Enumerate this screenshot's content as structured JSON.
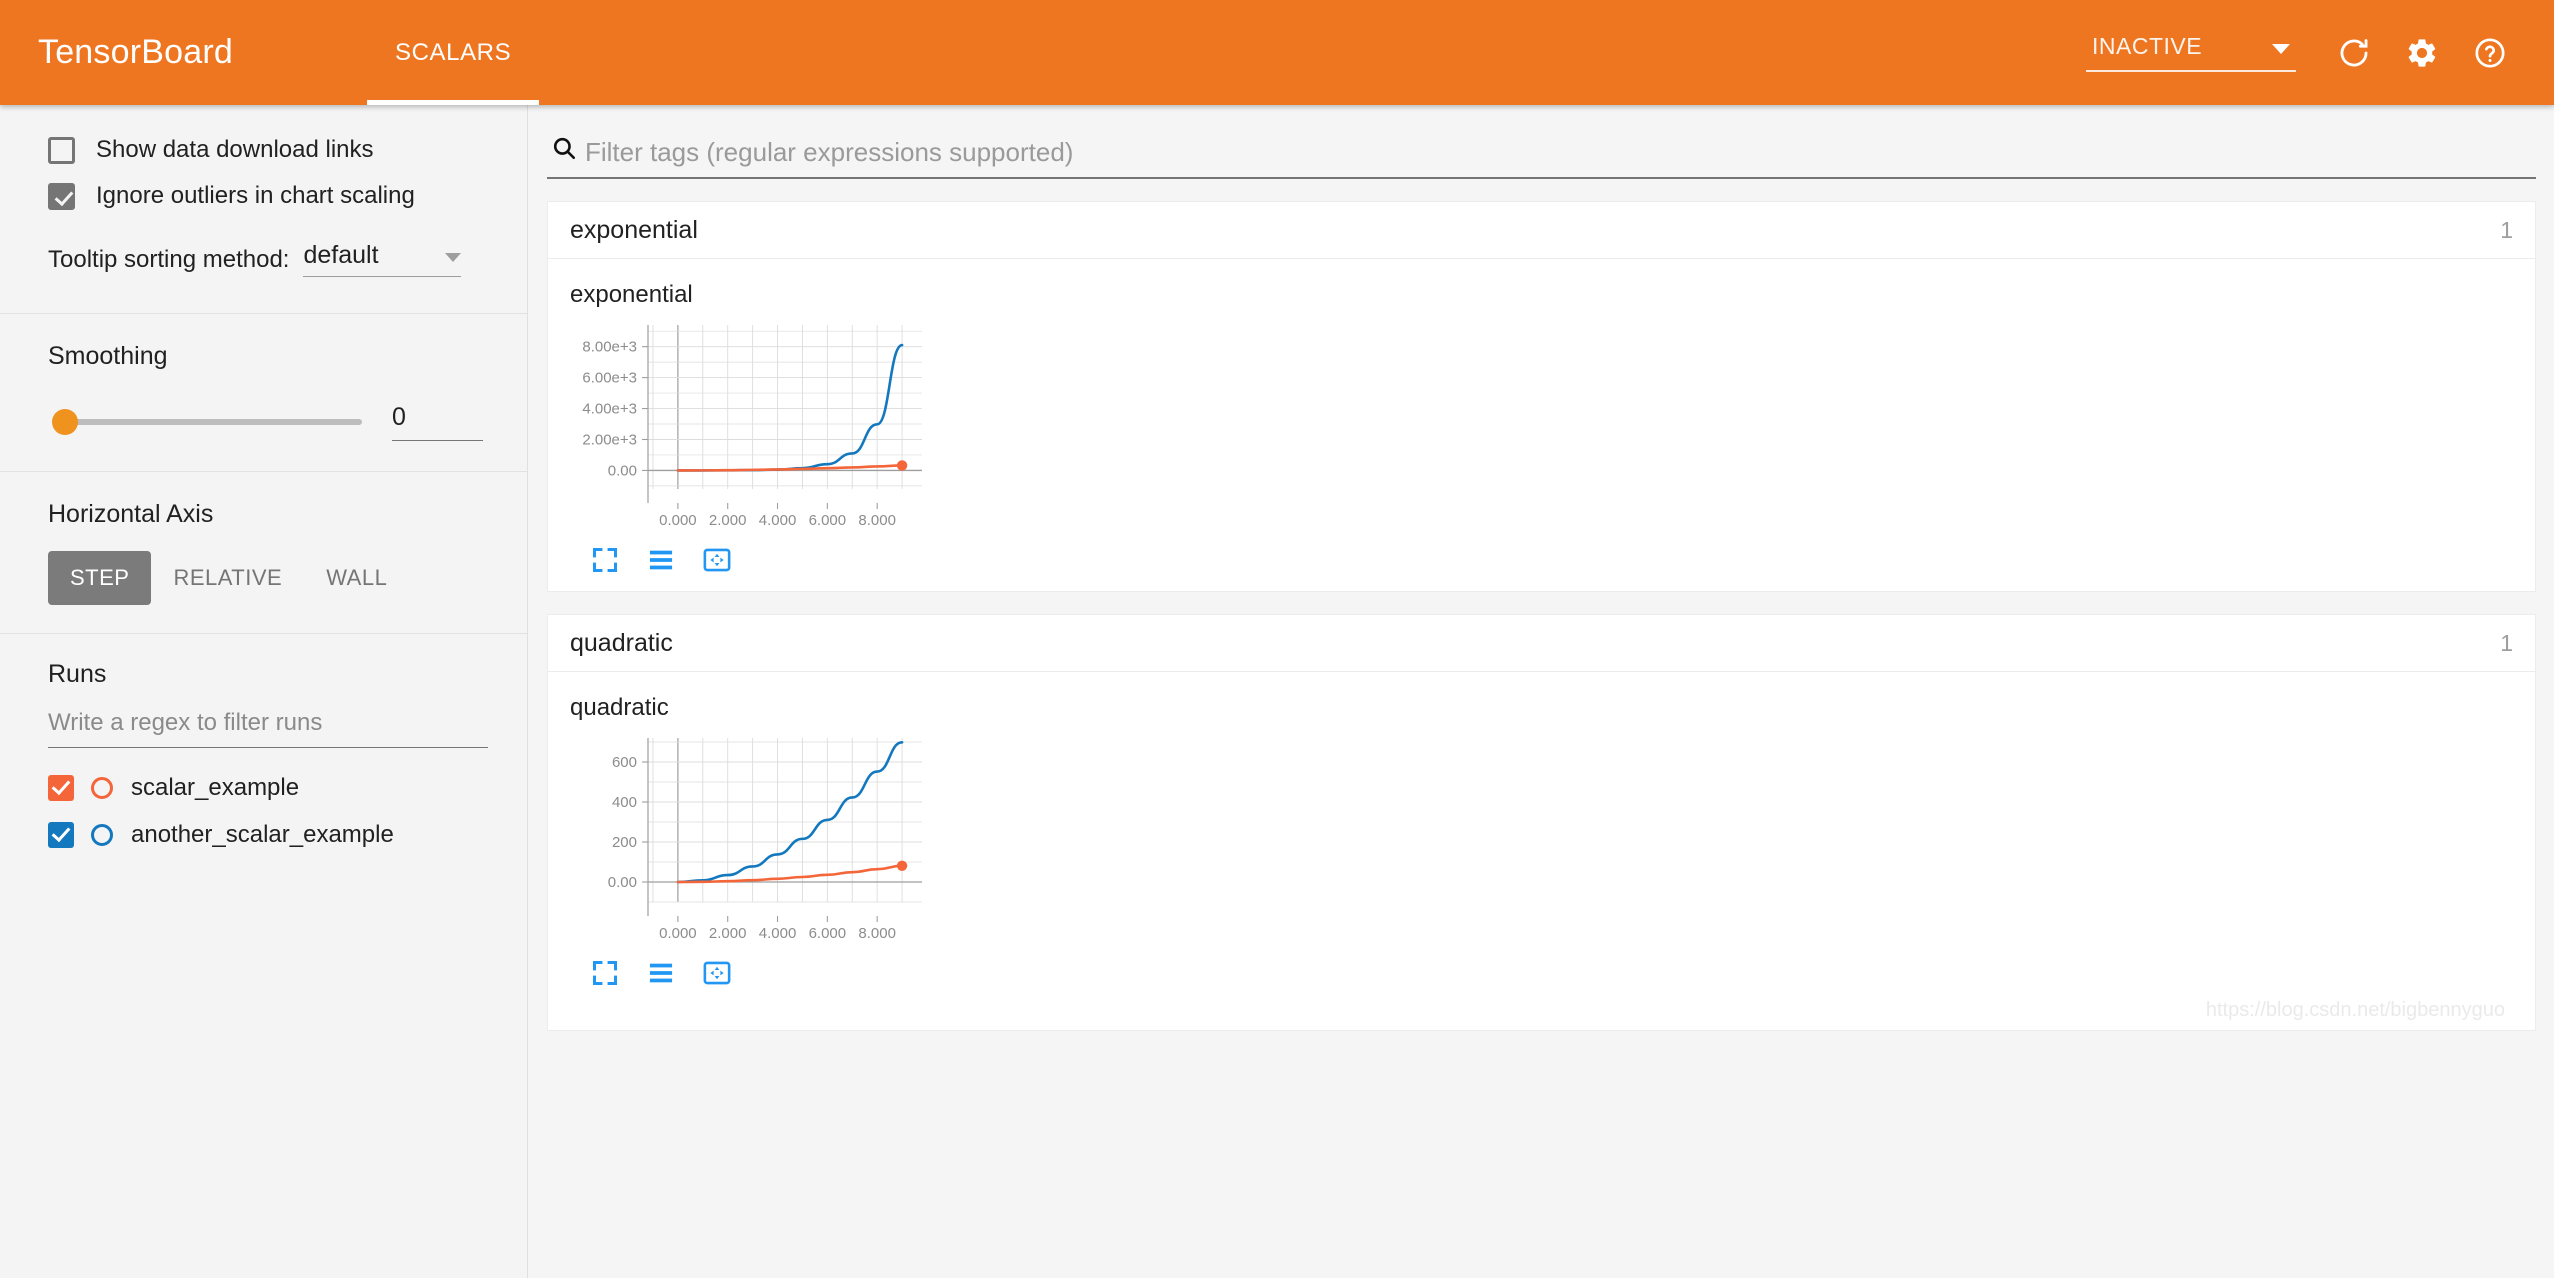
{
  "header": {
    "brand": "TensorBoard",
    "tabs": [
      {
        "label": "SCALARS",
        "active": true
      }
    ],
    "run_selector_value": "INACTIVE",
    "icons": {
      "refresh": "refresh-icon",
      "settings": "gear-icon",
      "help": "help-circle-icon",
      "dropdown": "chevron-down-icon"
    },
    "accent_color": "#ef7621"
  },
  "sidebar": {
    "checkboxes": [
      {
        "label": "Show data download links",
        "checked": false
      },
      {
        "label": "Ignore outliers in chart scaling",
        "checked": true
      }
    ],
    "tooltip_sort": {
      "label": "Tooltip sorting method:",
      "value": "default"
    },
    "smoothing": {
      "heading": "Smoothing",
      "value": "0",
      "slider_position_percent": 0
    },
    "horizontal_axis": {
      "heading": "Horizontal Axis",
      "options": [
        {
          "label": "STEP",
          "active": true
        },
        {
          "label": "RELATIVE",
          "active": false
        },
        {
          "label": "WALL",
          "active": false
        }
      ]
    },
    "runs": {
      "heading": "Runs",
      "filter_placeholder": "Write a regex to filter runs",
      "filter_value": "",
      "items": [
        {
          "name": "scalar_example",
          "checked": true,
          "color": "#f4663a"
        },
        {
          "name": "another_scalar_example",
          "checked": true,
          "color": "#1478be"
        }
      ]
    }
  },
  "main": {
    "search": {
      "placeholder": "Filter tags (regular expressions supported)",
      "value": "",
      "icon": "search-icon"
    },
    "groups": [
      {
        "title": "exponential",
        "count": "1",
        "chart_controls": [
          "fullscreen-icon",
          "toggle-y-axis-icon",
          "data-fit-icon"
        ]
      },
      {
        "title": "quadratic",
        "count": "1",
        "chart_controls": [
          "fullscreen-icon",
          "toggle-y-axis-icon",
          "data-fit-icon"
        ]
      }
    ],
    "watermark": "https://blog.csdn.net/bigbennyguo"
  },
  "chart_data": [
    {
      "type": "line",
      "title": "exponential",
      "xlabel": "",
      "ylabel": "",
      "xlim": [
        -1.2,
        9.8
      ],
      "ylim": [
        -1200,
        9400
      ],
      "xticks": [
        "0.000",
        "2.000",
        "4.000",
        "6.000",
        "8.000"
      ],
      "xtick_values": [
        0,
        2,
        4,
        6,
        8
      ],
      "yticks": [
        "0.00",
        "2.00e+3",
        "4.00e+3",
        "6.00e+3",
        "8.00e+3"
      ],
      "ytick_values": [
        0,
        2000,
        4000,
        6000,
        8000
      ],
      "grid": true,
      "legend": "none",
      "x": [
        0,
        1,
        2,
        3,
        4,
        5,
        6,
        7,
        8,
        9
      ],
      "series": [
        {
          "name": "another_scalar_example",
          "color": "#1478be",
          "values": [
            1,
            2.7,
            7.4,
            20,
            55,
            148,
            403,
            1097,
            2981,
            8103
          ]
        },
        {
          "name": "scalar_example",
          "color": "#f4663a",
          "values": [
            0,
            4,
            16,
            36,
            64,
            100,
            144,
            196,
            256,
            324
          ],
          "marker_last": true
        }
      ]
    },
    {
      "type": "line",
      "title": "quadratic",
      "xlabel": "",
      "ylabel": "",
      "xlim": [
        -1.2,
        9.8
      ],
      "ylim": [
        -100,
        720
      ],
      "xticks": [
        "0.000",
        "2.000",
        "4.000",
        "6.000",
        "8.000"
      ],
      "xtick_values": [
        0,
        2,
        4,
        6,
        8
      ],
      "yticks": [
        "0.00",
        "200",
        "400",
        "600"
      ],
      "ytick_values": [
        0,
        200,
        400,
        600
      ],
      "grid": true,
      "legend": "none",
      "x": [
        0,
        1,
        2,
        3,
        4,
        5,
        6,
        7,
        8,
        9
      ],
      "series": [
        {
          "name": "another_scalar_example",
          "color": "#1478be",
          "values": [
            0,
            8.6,
            34.5,
            77.6,
            138,
            215.6,
            310.5,
            422.6,
            552,
            698.6
          ]
        },
        {
          "name": "scalar_example",
          "color": "#f4663a",
          "values": [
            0,
            1,
            4,
            9,
            16,
            25,
            36,
            49,
            64,
            81
          ],
          "marker_last": true
        }
      ]
    }
  ]
}
